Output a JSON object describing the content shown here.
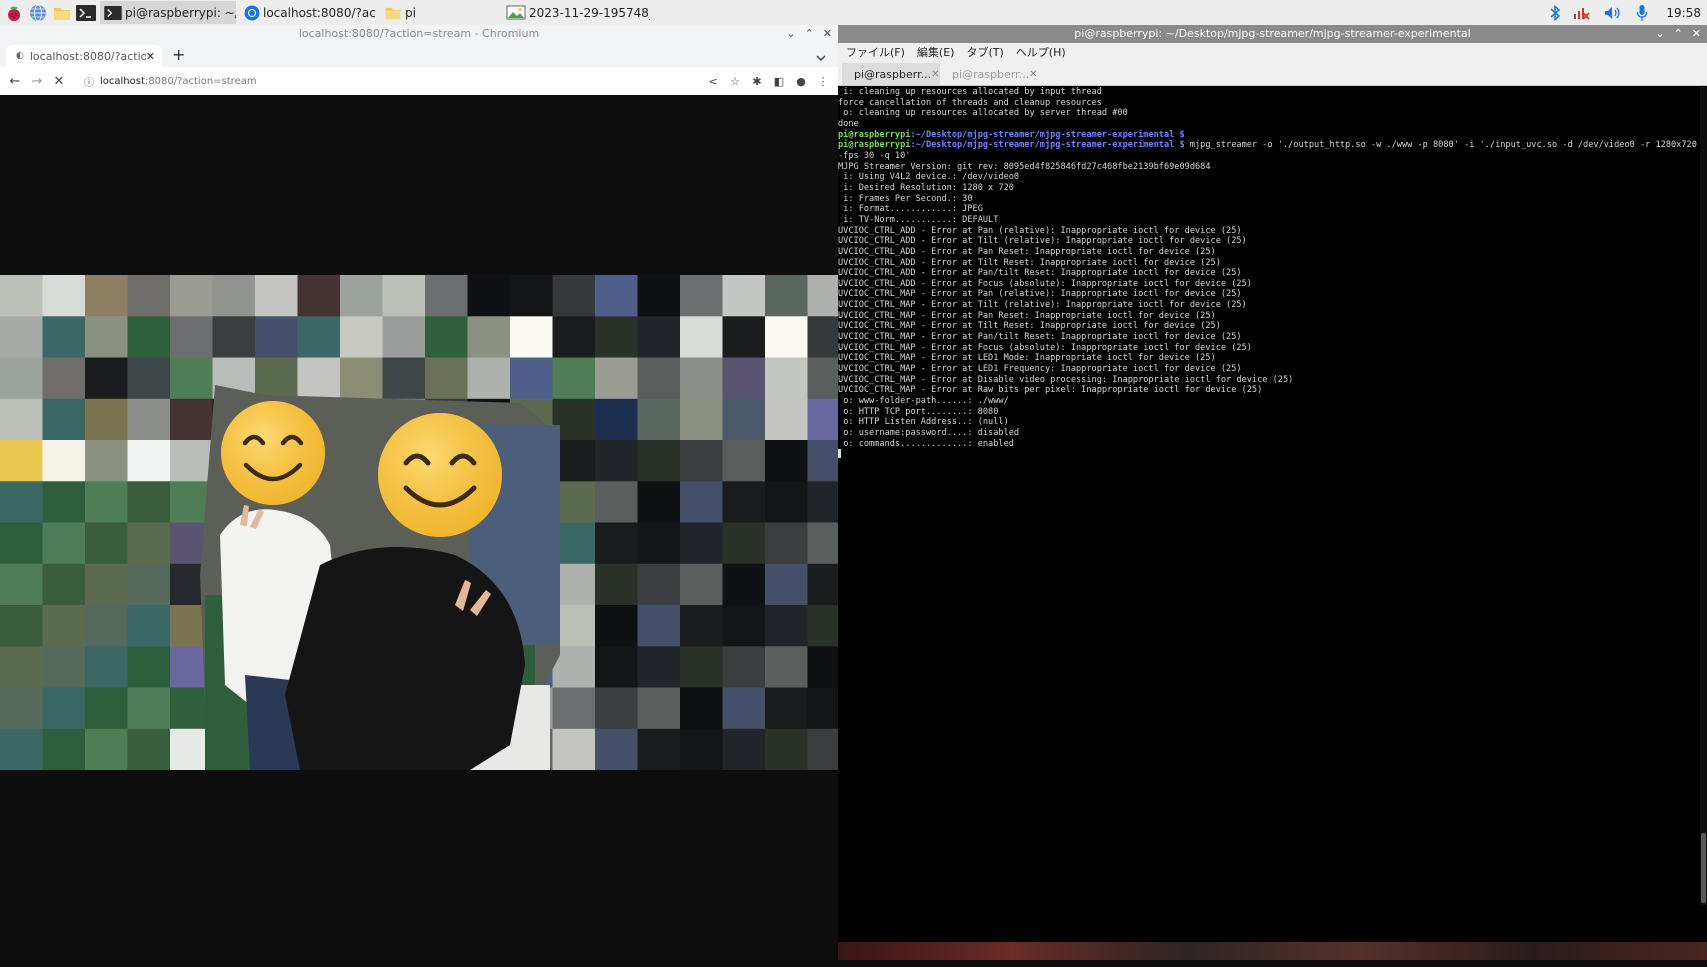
{
  "taskbar": {
    "tasks": [
      {
        "label": "pi@raspberrypi: ~/De..."
      },
      {
        "label": "localhost:8080/?acti..."
      },
      {
        "label": "pi"
      },
      {
        "label": "2023-11-29-195748_..."
      }
    ],
    "clock": "19:58"
  },
  "chromium": {
    "window_title": "localhost:8080/?action=stream - Chromium",
    "tab_title": "localhost:8080/?action=stream",
    "url_host": "localhost",
    "url_path": ":8080/?action=stream"
  },
  "terminal": {
    "window_title": "pi@raspberrypi: ~/Desktop/mjpg-streamer/mjpg-streamer-experimental",
    "menu": [
      "ファイル(F)",
      "編集(E)",
      "タブ(T)",
      "ヘルプ(H)"
    ],
    "tabs": [
      {
        "label": "pi@raspberr..."
      },
      {
        "label": "pi@raspberr..."
      }
    ],
    "prompt_user": "pi@raspberrypi",
    "prompt_path": ":~/Desktop/mjpg-streamer/mjpg-streamer-experimental $",
    "command": " mjpg_streamer -o './output_http.so -w ./www -p 8080' -i './input_uvc.so -d /dev/video0 -r 1280x720 -fps 30 -q 10'",
    "lines_before": [
      " i: cleaning up resources allocated by input thread",
      "force cancellation of threads and cleanup resources",
      " o: cleaning up resources allocated by server thread #00",
      "done"
    ],
    "lines_after": [
      "MJPG Streamer Version: git rev: 8095ed4f825846fd27c468fbe2139bf69e09d684",
      " i: Using V4L2 device.: /dev/video0",
      " i: Desired Resolution: 1280 x 720",
      " i: Frames Per Second.: 30",
      " i: Format............: JPEG",
      " i: TV-Norm...........: DEFAULT",
      "UVCIOC_CTRL_ADD - Error at Pan (relative): Inappropriate ioctl for device (25)",
      "UVCIOC_CTRL_ADD - Error at Tilt (relative): Inappropriate ioctl for device (25)",
      "UVCIOC_CTRL_ADD - Error at Pan Reset: Inappropriate ioctl for device (25)",
      "UVCIOC_CTRL_ADD - Error at Tilt Reset: Inappropriate ioctl for device (25)",
      "UVCIOC_CTRL_ADD - Error at Pan/tilt Reset: Inappropriate ioctl for device (25)",
      "UVCIOC_CTRL_ADD - Error at Focus (absolute): Inappropriate ioctl for device (25)",
      "UVCIOC_CTRL_MAP - Error at Pan (relative): Inappropriate ioctl for device (25)",
      "UVCIOC_CTRL_MAP - Error at Tilt (relative): Inappropriate ioctl for device (25)",
      "UVCIOC_CTRL_MAP - Error at Pan Reset: Inappropriate ioctl for device (25)",
      "UVCIOC_CTRL_MAP - Error at Tilt Reset: Inappropriate ioctl for device (25)",
      "UVCIOC_CTRL_MAP - Error at Pan/tilt Reset: Inappropriate ioctl for device (25)",
      "UVCIOC_CTRL_MAP - Error at Focus (absolute): Inappropriate ioctl for device (25)",
      "UVCIOC_CTRL_MAP - Error at LED1 Mode: Inappropriate ioctl for device (25)",
      "UVCIOC_CTRL_MAP - Error at LED1 Frequency: Inappropriate ioctl for device (25)",
      "UVCIOC_CTRL_MAP - Error at Disable video processing: Inappropriate ioctl for device (25)",
      "UVCIOC_CTRL_MAP - Error at Raw bits per pixel: Inappropriate ioctl for device (25)",
      " o: www-folder-path......: ./www/",
      " o: HTTP TCP port........: 8080",
      " o: HTTP Listen Address..: (null)",
      " o: username:password....: disabled",
      " o: commands.............: enabled"
    ]
  },
  "icons": {
    "raspberry": "raspberry-menu-icon",
    "browser": "web-browser-icon",
    "files": "file-manager-icon",
    "terminal": "terminal-icon",
    "bluetooth": "bluetooth-icon",
    "network": "network-disconnected-icon",
    "volume": "volume-icon",
    "mic": "microphone-icon"
  },
  "colors": {
    "prompt_user": "#7ddc5a",
    "prompt_path": "#6f86ff",
    "bluetooth": "#1a73e8",
    "network_error": "#d93025"
  }
}
